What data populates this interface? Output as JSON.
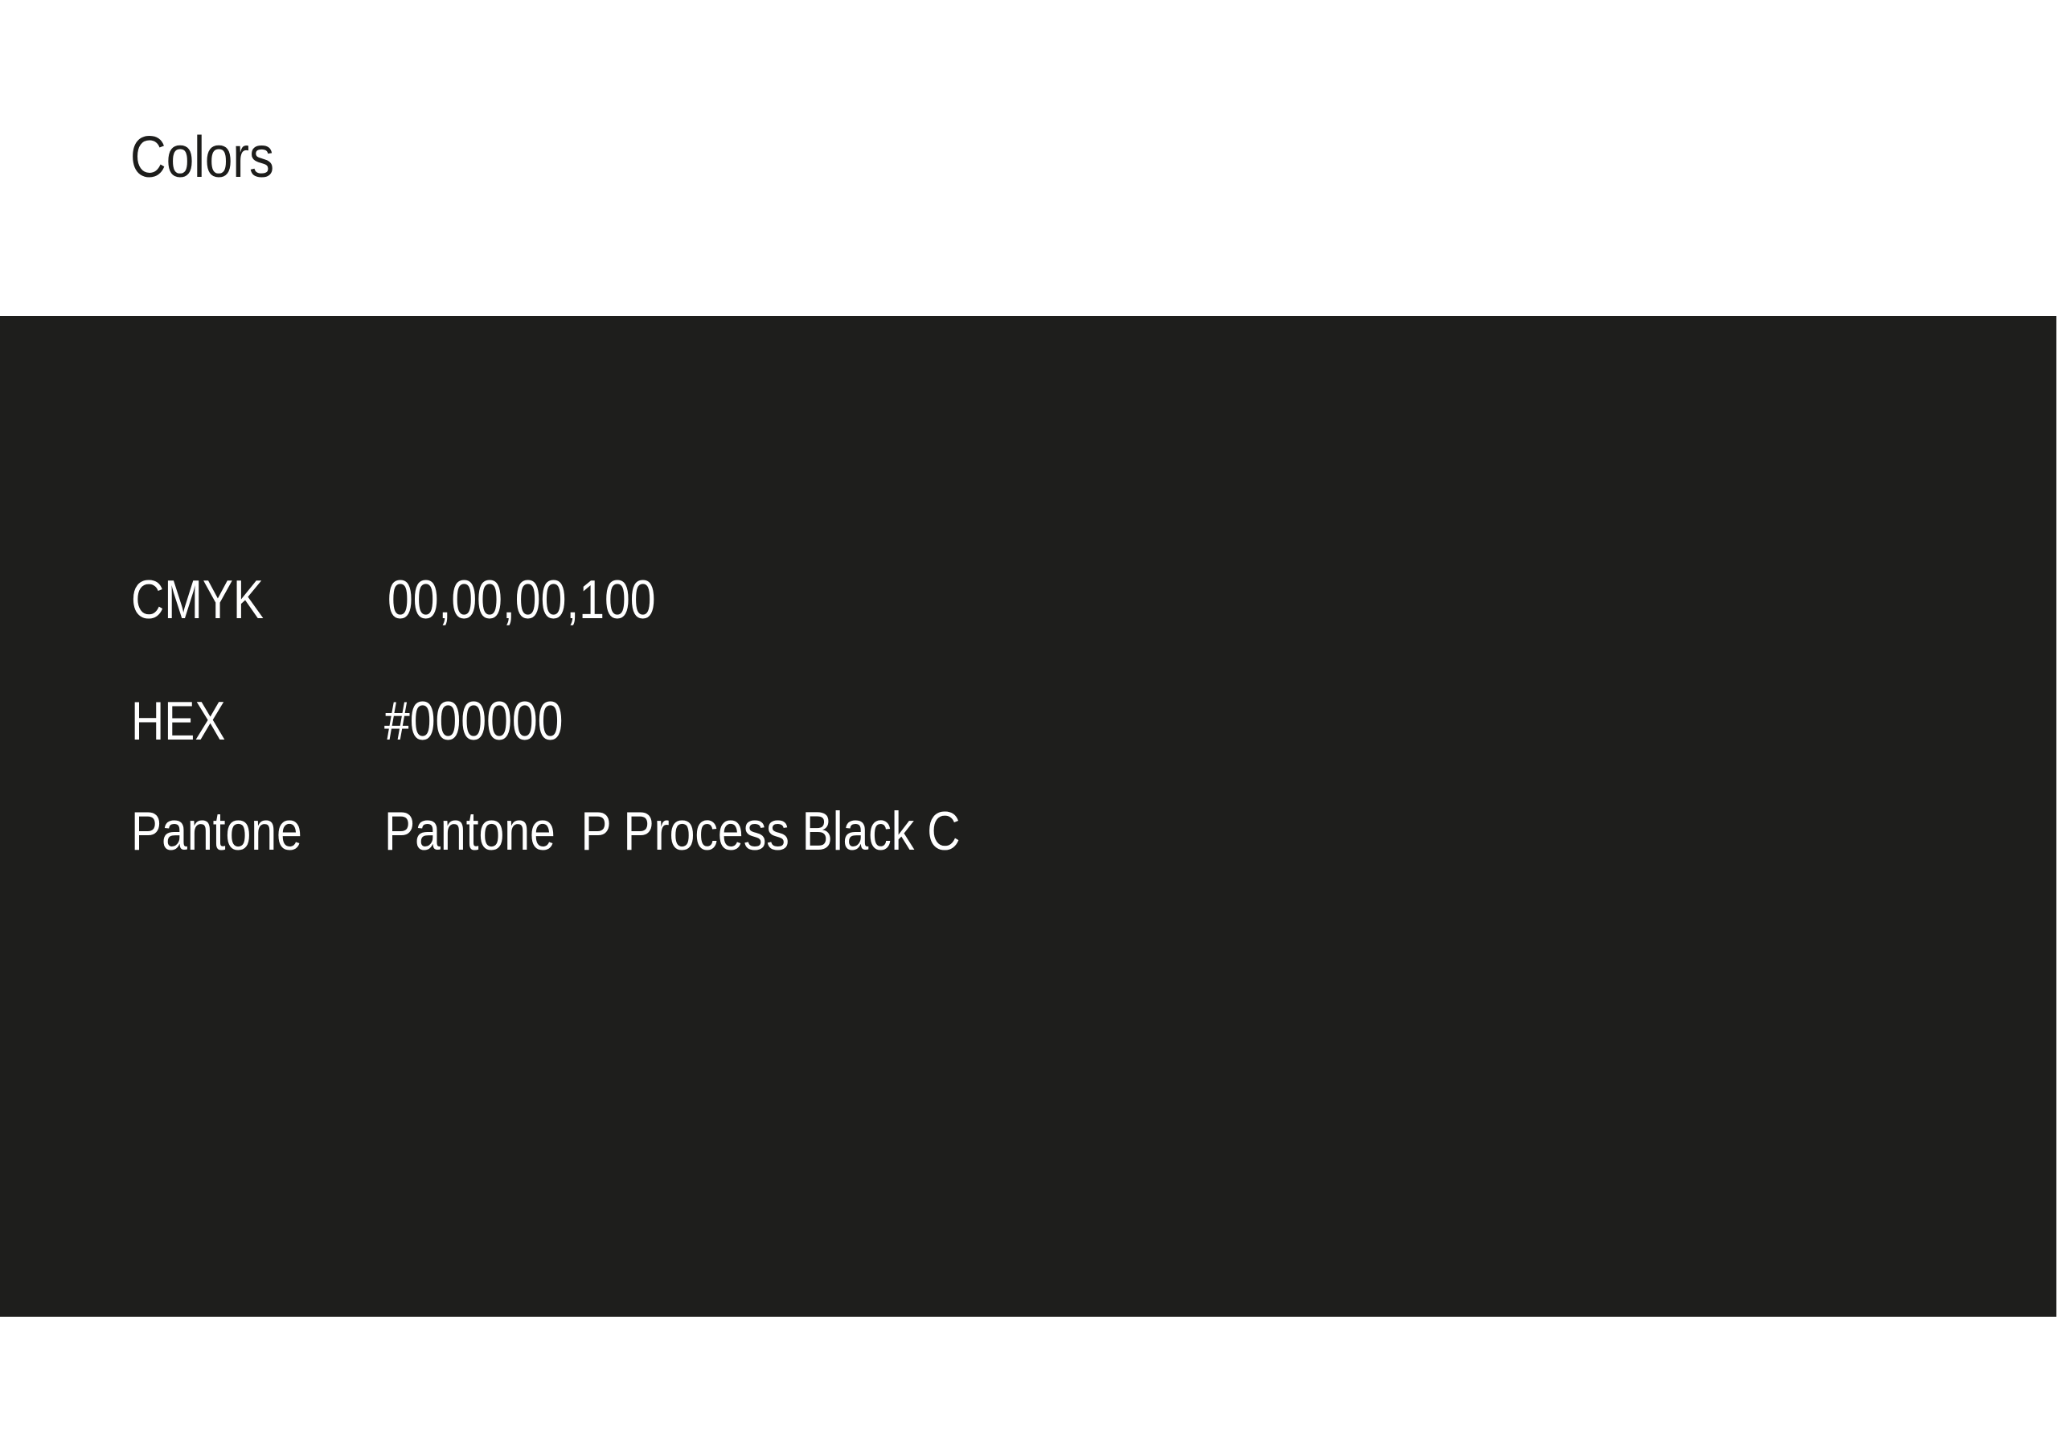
{
  "title": "Colors",
  "swatch": {
    "color": "#1e1e1c",
    "rows": [
      {
        "label": "CMYK",
        "value": "00,00,00,100"
      },
      {
        "label": "HEX",
        "value": "#000000"
      },
      {
        "label": "Pantone",
        "value": "Pantone  P Process Black C"
      }
    ]
  }
}
